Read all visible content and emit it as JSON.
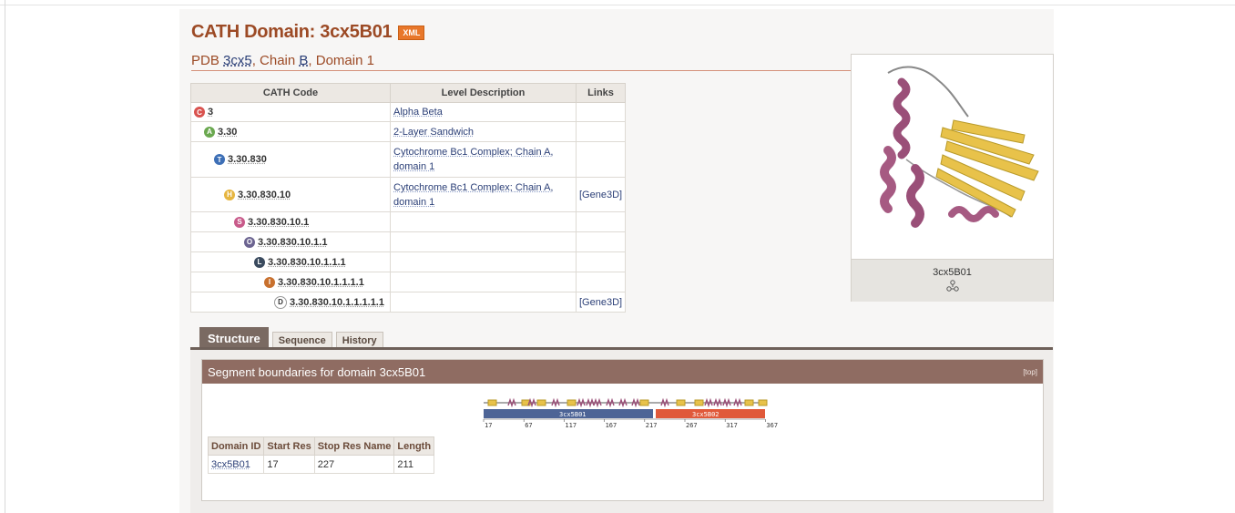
{
  "header": {
    "title": "CATH Domain: 3cx5B01",
    "xml_badge": "XML",
    "pdb_prefix": "PDB",
    "pdb_id": "3cx5",
    "chain_prefix": ", Chain",
    "chain_id": "B",
    "domain_suffix": ", Domain 1"
  },
  "cath_table": {
    "columns": [
      "CATH Code",
      "Level Description",
      "Links"
    ],
    "rows": [
      {
        "icon": "class-level-icon",
        "letter": "C",
        "color": "#d9534f",
        "code": "3",
        "desc": "Alpha Beta",
        "link": ""
      },
      {
        "icon": "architecture-level-icon",
        "letter": "A",
        "color": "#6aa84f",
        "code": "3.30",
        "desc": "2-Layer Sandwich",
        "link": ""
      },
      {
        "icon": "topology-level-icon",
        "letter": "T",
        "color": "#3d6fb6",
        "code": "3.30.830",
        "desc": "Cytochrome Bc1 Complex; Chain A, domain 1",
        "link": ""
      },
      {
        "icon": "homology-level-icon",
        "letter": "H",
        "color": "#e6b540",
        "code": "3.30.830.10",
        "desc": "Cytochrome Bc1 Complex; Chain A, domain 1",
        "link": "[Gene3D]"
      },
      {
        "icon": "s-level-icon",
        "letter": "S",
        "color": "#c85a8a",
        "code": "3.30.830.10.1",
        "desc": "",
        "link": ""
      },
      {
        "icon": "o-level-icon",
        "letter": "O",
        "color": "#6b6390",
        "code": "3.30.830.10.1.1",
        "desc": "",
        "link": ""
      },
      {
        "icon": "l-level-icon",
        "letter": "L",
        "color": "#3a4a5e",
        "code": "3.30.830.10.1.1.1",
        "desc": "",
        "link": ""
      },
      {
        "icon": "i-level-icon",
        "letter": "I",
        "color": "#c8702e",
        "code": "3.30.830.10.1.1.1.1",
        "desc": "",
        "link": ""
      },
      {
        "icon": "domain-level-icon",
        "letter": "D",
        "color": "#ffffff",
        "code": "3.30.830.10.1.1.1.1.1",
        "desc": "",
        "link": "[Gene3D]"
      }
    ]
  },
  "image_panel": {
    "caption": "3cx5B01",
    "caption_icon": "molecule-icon",
    "image_icon": "protein-structure-icon"
  },
  "tabs": [
    {
      "label": "Structure",
      "active": true
    },
    {
      "label": "Sequence",
      "active": false
    },
    {
      "label": "History",
      "active": false
    }
  ],
  "segment_panel": {
    "title": "Segment boundaries for domain 3cx5B01",
    "top_link": "[top]",
    "diagram": {
      "domain1_label": "3cx5B01",
      "domain2_label": "3cx5B02",
      "domain1_color": "#4d6496",
      "domain2_color": "#e0593a",
      "ticks": [
        "17",
        "67",
        "117",
        "167",
        "217",
        "267",
        "317",
        "367"
      ]
    },
    "table": {
      "columns": [
        "Domain ID",
        "Start Res",
        "Stop Res Name",
        "Length"
      ],
      "rows": [
        {
          "domain_id": "3cx5B01",
          "start": "17",
          "stop": "227",
          "length": "211"
        }
      ]
    }
  }
}
